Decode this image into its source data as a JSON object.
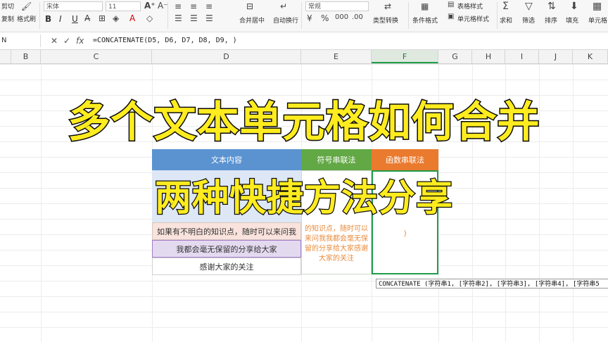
{
  "ribbon": {
    "cut": "剪切",
    "copy": "复制",
    "format_painter": "格式刷",
    "font": "宋体",
    "size": "11",
    "bold": "B",
    "italic": "I",
    "underline": "U",
    "merge": "合并居中",
    "wrap": "自动换行",
    "number_format": "常规",
    "type_convert": "类型转换",
    "cond_format": "条件格式",
    "table_style": "表格样式",
    "cell_style": "单元格样式",
    "sum": "求和",
    "filter": "筛选",
    "sort": "排序",
    "fill": "填充",
    "cell": "单元格"
  },
  "formula_bar": {
    "name_box": "N",
    "cancel": "✕",
    "confirm": "✓",
    "fx": "fx",
    "formula": "=CONCATENATE(D5, D6, D7, D8, D9, )"
  },
  "columns": [
    "B",
    "C",
    "D",
    "E",
    "F",
    "G",
    "H",
    "I",
    "J",
    "K"
  ],
  "active_column": "F",
  "table": {
    "header_d": "文本内容",
    "header_e": "符号串联法",
    "header_f": "函数串联法",
    "rows": [
      {
        "d": "如果有不明白的知识点，随时可以来问我",
        "e": "的知识点，随时可以"
      },
      {
        "d": "我都会毫无保留的分享给大家",
        "e": "来问我我都会毫无保"
      },
      {
        "d": "感谢大家的关注",
        "e": "留的分享给大家感谢"
      }
    ],
    "e_tail": "大家的关注",
    "f_partial": ")"
  },
  "overlay": {
    "title": "多个文本单元格如何合并",
    "subtitle": "两种快捷方法分享"
  },
  "tooltip": "CONCATENATE (字符串1, [字符串2], [字符串3], [字符串4], [字符串5"
}
